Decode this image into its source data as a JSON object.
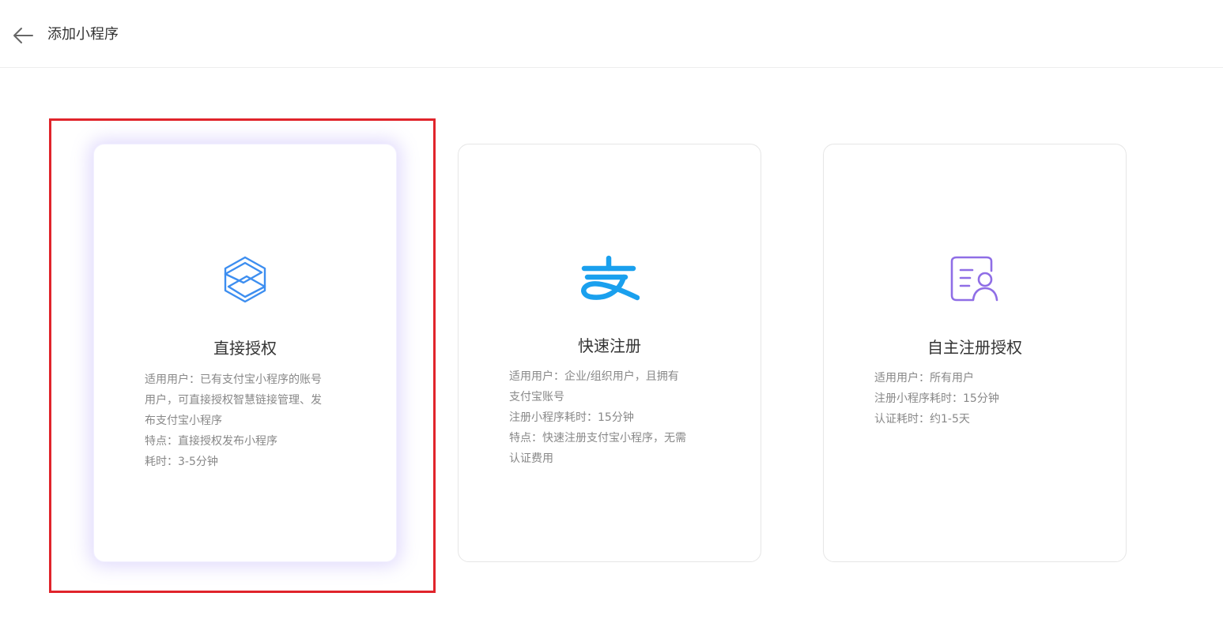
{
  "header": {
    "back_icon": "arrow-left-icon",
    "title": "添加小程序"
  },
  "options": [
    {
      "id": "direct-auth",
      "icon": "hexagon-box-icon",
      "icon_color": "#3d8ef0",
      "selected": true,
      "title": "直接授权",
      "lines": [
        "适用用户：已有支付宝小程序的账号",
        "用户，可直接授权智慧链接管理、发",
        "布支付宝小程序",
        "特点：直接授权发布小程序",
        "耗时：3-5分钟"
      ]
    },
    {
      "id": "quick-register",
      "icon": "alipay-logo-icon",
      "icon_color": "#1aa0ee",
      "selected": false,
      "title": "快速注册",
      "lines": [
        "适用用户：企业/组织用户，且拥有",
        "支付宝账号",
        "注册小程序耗时：15分钟",
        "特点：快速注册支付宝小程序，无需",
        "认证费用"
      ]
    },
    {
      "id": "self-register",
      "icon": "id-card-person-icon",
      "icon_color": "#8f6ee6",
      "selected": false,
      "title": "自主注册授权",
      "lines": [
        "适用用户：所有用户",
        "注册小程序耗时：15分钟",
        "认证耗时：约1-5天"
      ]
    }
  ],
  "highlight_color": "#e0242b"
}
